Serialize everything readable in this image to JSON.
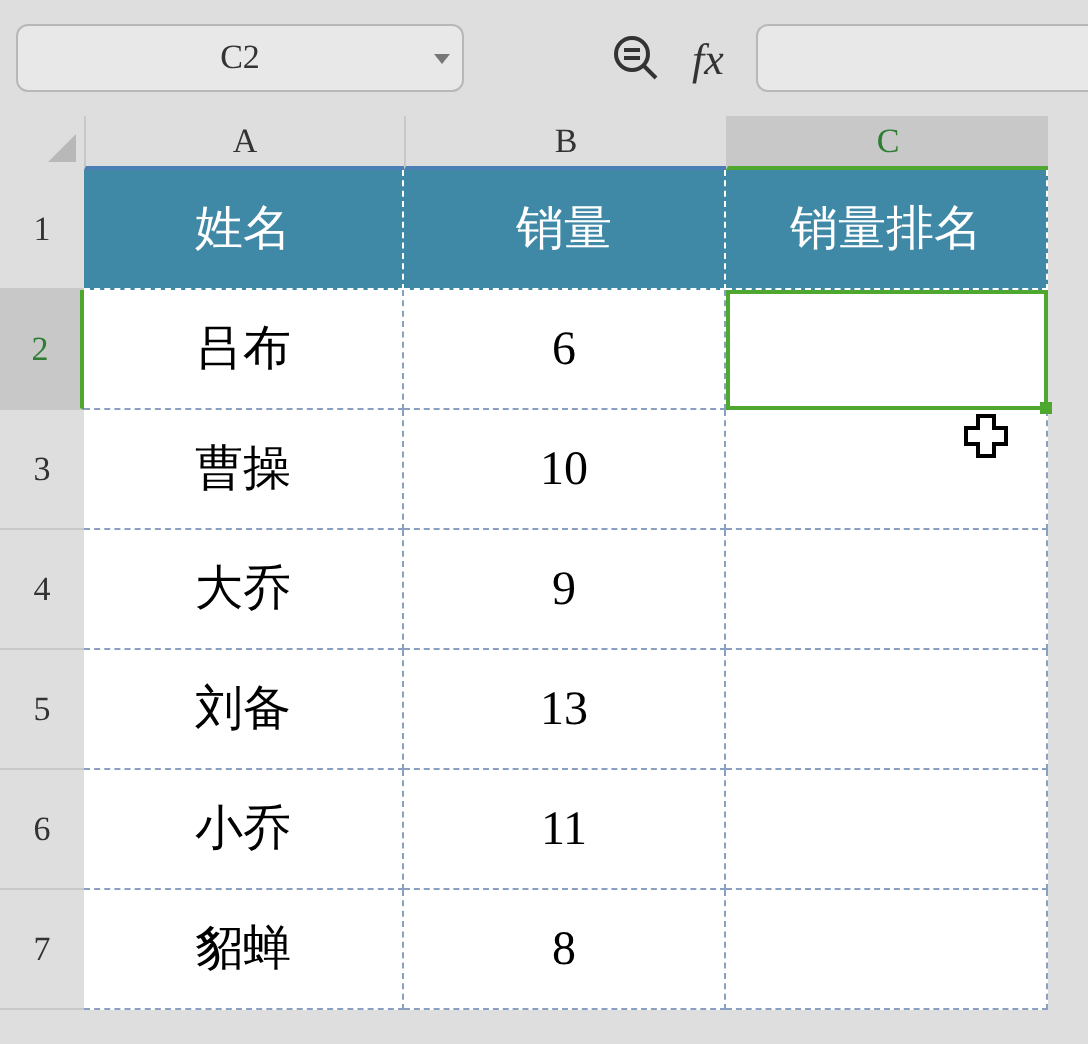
{
  "name_box": {
    "value": "C2"
  },
  "formula_bar": {
    "fx": "fx"
  },
  "columns": [
    {
      "label": "A",
      "selected": false
    },
    {
      "label": "B",
      "selected": false
    },
    {
      "label": "C",
      "selected": true
    }
  ],
  "rows": [
    {
      "number": "1",
      "selected": false,
      "kind": "header",
      "cells": [
        {
          "text": "姓名",
          "selected": false
        },
        {
          "text": "销量",
          "selected": false
        },
        {
          "text": "销量排名",
          "selected": false
        }
      ]
    },
    {
      "number": "2",
      "selected": true,
      "kind": "data",
      "cells": [
        {
          "text": "吕布",
          "selected": false
        },
        {
          "text": "6",
          "selected": false
        },
        {
          "text": "",
          "selected": true
        }
      ]
    },
    {
      "number": "3",
      "selected": false,
      "kind": "data",
      "cells": [
        {
          "text": "曹操",
          "selected": false
        },
        {
          "text": "10",
          "selected": false
        },
        {
          "text": "",
          "selected": false
        }
      ]
    },
    {
      "number": "4",
      "selected": false,
      "kind": "data",
      "cells": [
        {
          "text": "大乔",
          "selected": false
        },
        {
          "text": "9",
          "selected": false
        },
        {
          "text": "",
          "selected": false
        }
      ]
    },
    {
      "number": "5",
      "selected": false,
      "kind": "data",
      "cells": [
        {
          "text": "刘备",
          "selected": false
        },
        {
          "text": "13",
          "selected": false
        },
        {
          "text": "",
          "selected": false
        }
      ]
    },
    {
      "number": "6",
      "selected": false,
      "kind": "data",
      "cells": [
        {
          "text": "小乔",
          "selected": false
        },
        {
          "text": "11",
          "selected": false
        },
        {
          "text": "",
          "selected": false
        }
      ]
    },
    {
      "number": "7",
      "selected": false,
      "kind": "data",
      "cells": [
        {
          "text": "貂蝉",
          "selected": false
        },
        {
          "text": "8",
          "selected": false
        },
        {
          "text": "",
          "selected": false
        }
      ]
    }
  ]
}
